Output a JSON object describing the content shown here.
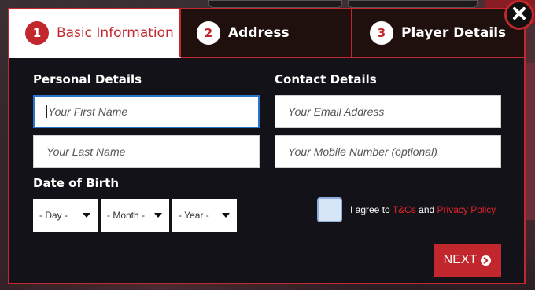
{
  "tabs": [
    {
      "number": "1",
      "label": "Basic Information"
    },
    {
      "number": "2",
      "label": "Address"
    },
    {
      "number": "3",
      "label": "Player Details"
    }
  ],
  "personal": {
    "heading": "Personal Details",
    "first_name_placeholder": "Your First Name",
    "last_name_placeholder": "Your Last Name"
  },
  "contact": {
    "heading": "Contact Details",
    "email_placeholder": "Your Email Address",
    "mobile_placeholder": "Your Mobile Number (optional)"
  },
  "dob": {
    "heading": "Date of Birth",
    "day": "- Day -",
    "month": "- Month -",
    "year": "- Year -"
  },
  "agreement": {
    "prefix": "I agree to",
    "tcs": "T&Cs",
    "and": "and",
    "privacy": "Privacy Policy"
  },
  "next_label": "NEXT",
  "colors": {
    "accent": "#c2272d",
    "modal_bg": "#121218",
    "focus": "#2b73c8"
  },
  "icons": {
    "close": "close-x-icon",
    "next": "arrow-right-circle-icon"
  }
}
